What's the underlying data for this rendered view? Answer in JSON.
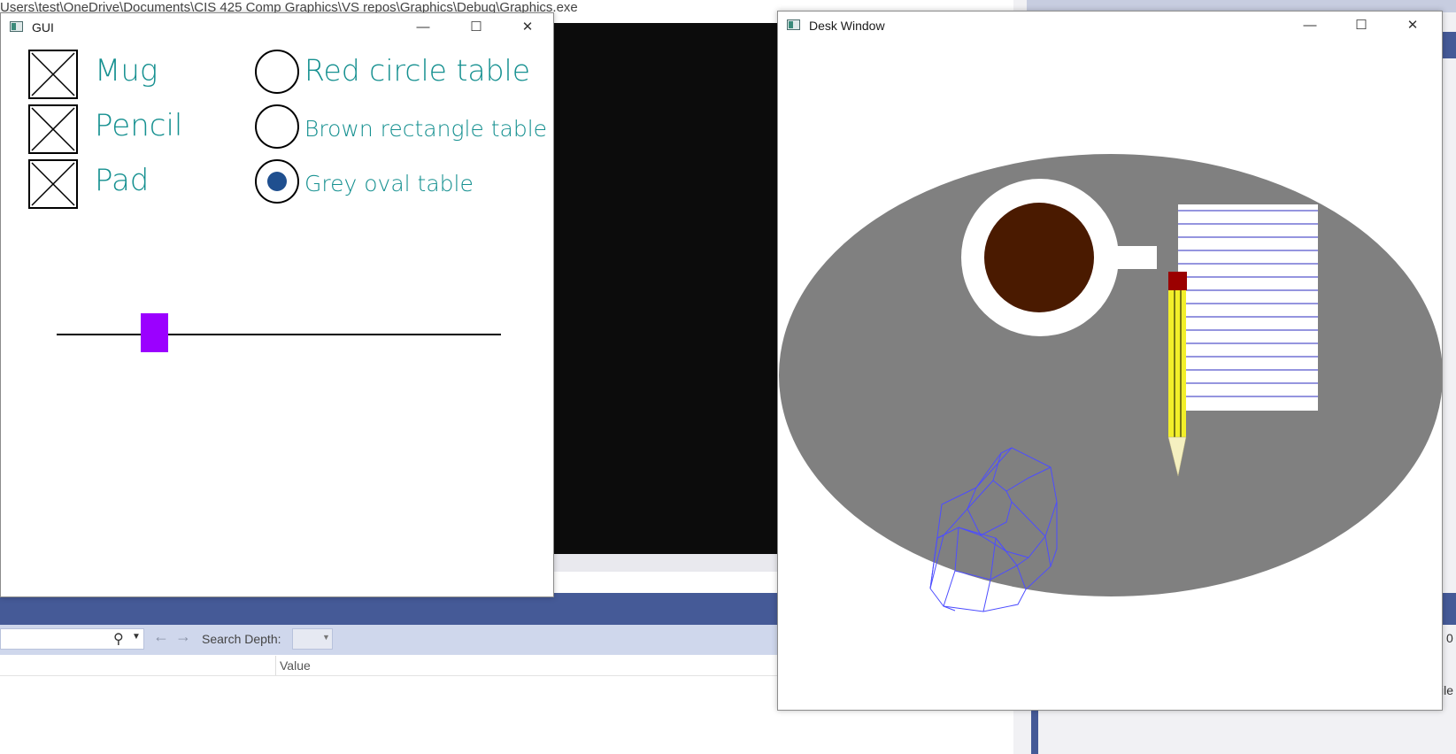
{
  "console": {
    "path": "Users\\test\\OneDrive\\Documents\\CIS 425 Comp Graphics\\VS repos\\Graphics\\Debug\\Graphics.exe"
  },
  "ide": {
    "search_icon": "search-icon",
    "back_icon": "arrow-left-icon",
    "forward_icon": "arrow-right-icon",
    "search_depth_label": "Search Depth:",
    "value_header": "Value",
    "right_zero": "0",
    "right_ile": "ile"
  },
  "gui_window": {
    "title": "GUI",
    "minimize": "—",
    "maximize": "☐",
    "close": "✕",
    "checkboxes": [
      {
        "label": "Mug",
        "checked": true
      },
      {
        "label": "Pencil",
        "checked": true
      },
      {
        "label": "Pad",
        "checked": true
      }
    ],
    "radios": [
      {
        "label": "Red  circle  table",
        "selected": false
      },
      {
        "label": "Brown  rectangle  table",
        "selected": false
      },
      {
        "label": "Grey  oval  table",
        "selected": true
      }
    ],
    "slider": {
      "value_fraction": 0.22,
      "color": "#9b00ff"
    },
    "label_color": "#159090"
  },
  "desk_window": {
    "title": "Desk Window",
    "minimize": "—",
    "maximize": "☐",
    "close": "✕",
    "scene": {
      "table_color": "#808080",
      "mug_rim_color": "#ffffff",
      "coffee_color": "#4a1a00",
      "pad_line_color": "#2b2bbf",
      "pencil_color": "#f2ef2a",
      "eraser_color": "#9b0000",
      "wireframe_color": "#4d4dff"
    }
  }
}
